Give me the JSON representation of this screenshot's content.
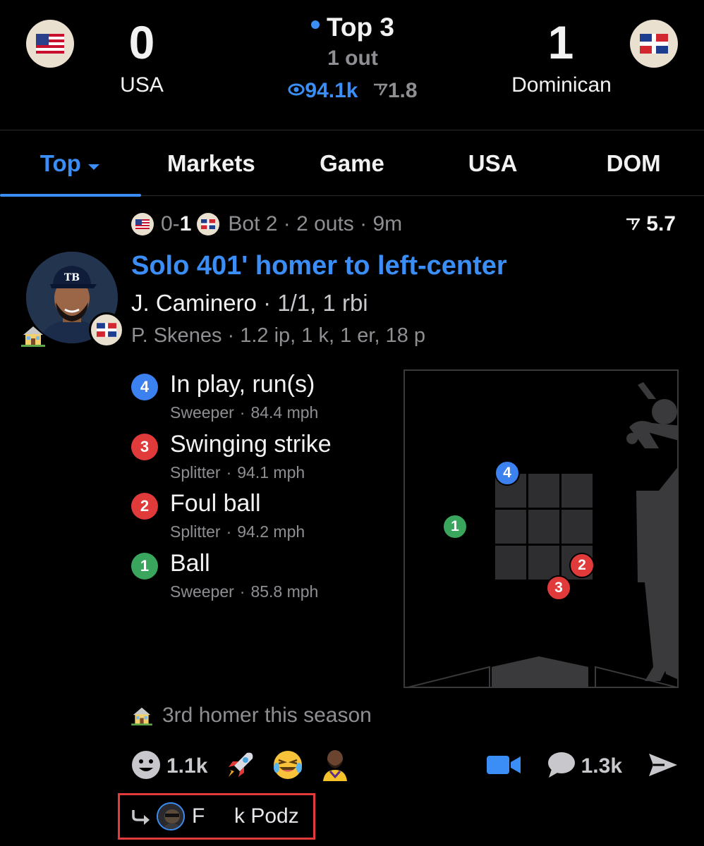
{
  "scoreboard": {
    "away": {
      "name": "USA",
      "score": "0",
      "flag_icon": "usa-flag-icon"
    },
    "home": {
      "name": "Dominican",
      "score": "1",
      "flag_icon": "dominican-flag-icon"
    },
    "inning": "Top 3",
    "outs": "1 out",
    "viewers": "94.1k",
    "votes": "1.8",
    "live_color": "#3b8ef5"
  },
  "tabs": [
    {
      "label": "Top",
      "active": true
    },
    {
      "label": "Markets",
      "active": false
    },
    {
      "label": "Game",
      "active": false
    },
    {
      "label": "USA",
      "active": false
    },
    {
      "label": "DOM",
      "active": false
    }
  ],
  "play": {
    "score_away": "0-",
    "score_home": "1",
    "context": "Bot 2 · 2 outs · 9m",
    "votes": "5.7",
    "title": "Solo 401' homer to left-center",
    "batter_name": "J. Caminero",
    "batter_stats": "· 1/1, 1 rbi",
    "pitcher": "P. Skenes · 1.2 ip, 1 k, 1 er, 18 p",
    "avatar_cap_logo": "TB",
    "note": "3rd homer this season"
  },
  "pitches": [
    {
      "num": "4",
      "result": "In play, run(s)",
      "type": "Sweeper",
      "speed": "84.4 mph",
      "color": "#3b82f0"
    },
    {
      "num": "3",
      "result": "Swinging strike",
      "type": "Splitter",
      "speed": "94.1 mph",
      "color": "#e03a3a"
    },
    {
      "num": "2",
      "result": "Foul ball",
      "type": "Splitter",
      "speed": "94.2 mph",
      "color": "#e03a3a"
    },
    {
      "num": "1",
      "result": "Ball",
      "type": "Sweeper",
      "speed": "85.8 mph",
      "color": "#3aa55d"
    }
  ],
  "reactions": {
    "smile_count": "1.1k",
    "comment_count": "1.3k",
    "emojis": [
      "rocket-icon",
      "laughing-emoji-icon",
      "player-emoji-icon"
    ]
  },
  "reply": {
    "name": "F     k Podz"
  }
}
